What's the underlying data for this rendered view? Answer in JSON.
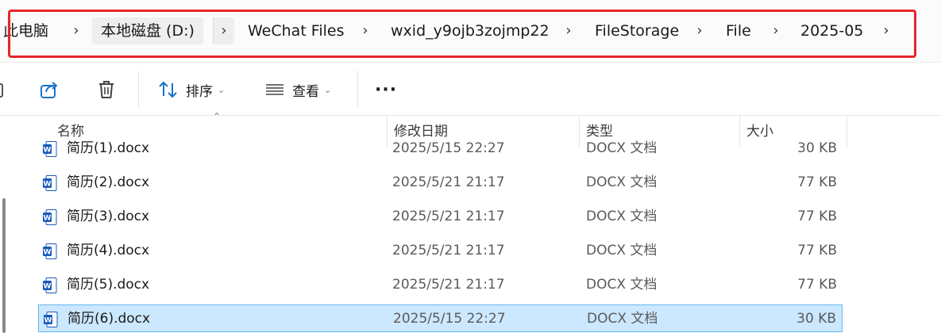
{
  "breadcrumb": {
    "items": [
      {
        "label": "此电脑"
      },
      {
        "label": "本地磁盘 (D:)"
      },
      {
        "label": "WeChat Files"
      },
      {
        "label": "wxid_y9ojb3zojmp22"
      },
      {
        "label": "FileStorage"
      },
      {
        "label": "File"
      },
      {
        "label": "2025-05"
      }
    ],
    "separator": "›"
  },
  "toolbar": {
    "sort_label": "排序",
    "view_label": "查看",
    "more_label": "···"
  },
  "table": {
    "columns": {
      "name": "名称",
      "date": "修改日期",
      "type": "类型",
      "size": "大小"
    },
    "rows": [
      {
        "name": "简历(1).docx",
        "date": "2025/5/15 22:27",
        "type": "DOCX 文档",
        "size": "30 KB",
        "selected": false
      },
      {
        "name": "简历(2).docx",
        "date": "2025/5/21 21:17",
        "type": "DOCX 文档",
        "size": "77 KB",
        "selected": false
      },
      {
        "name": "简历(3).docx",
        "date": "2025/5/21 21:17",
        "type": "DOCX 文档",
        "size": "77 KB",
        "selected": false
      },
      {
        "name": "简历(4).docx",
        "date": "2025/5/21 21:17",
        "type": "DOCX 文档",
        "size": "77 KB",
        "selected": false
      },
      {
        "name": "简历(5).docx",
        "date": "2025/5/21 21:17",
        "type": "DOCX 文档",
        "size": "77 KB",
        "selected": false
      },
      {
        "name": "简历(6).docx",
        "date": "2025/5/15 22:27",
        "type": "DOCX 文档",
        "size": "30 KB",
        "selected": true
      }
    ]
  },
  "colors": {
    "highlight_border": "#e8242b",
    "selection_fill": "#cce8ff",
    "selection_border": "#66b8f0",
    "word_blue": "#185abd"
  },
  "icons": {
    "share": "share-icon",
    "delete": "trash-icon",
    "sort": "sort-arrows-icon",
    "view": "view-lines-icon",
    "more": "more-dots-icon",
    "file": "word-doc-icon"
  }
}
